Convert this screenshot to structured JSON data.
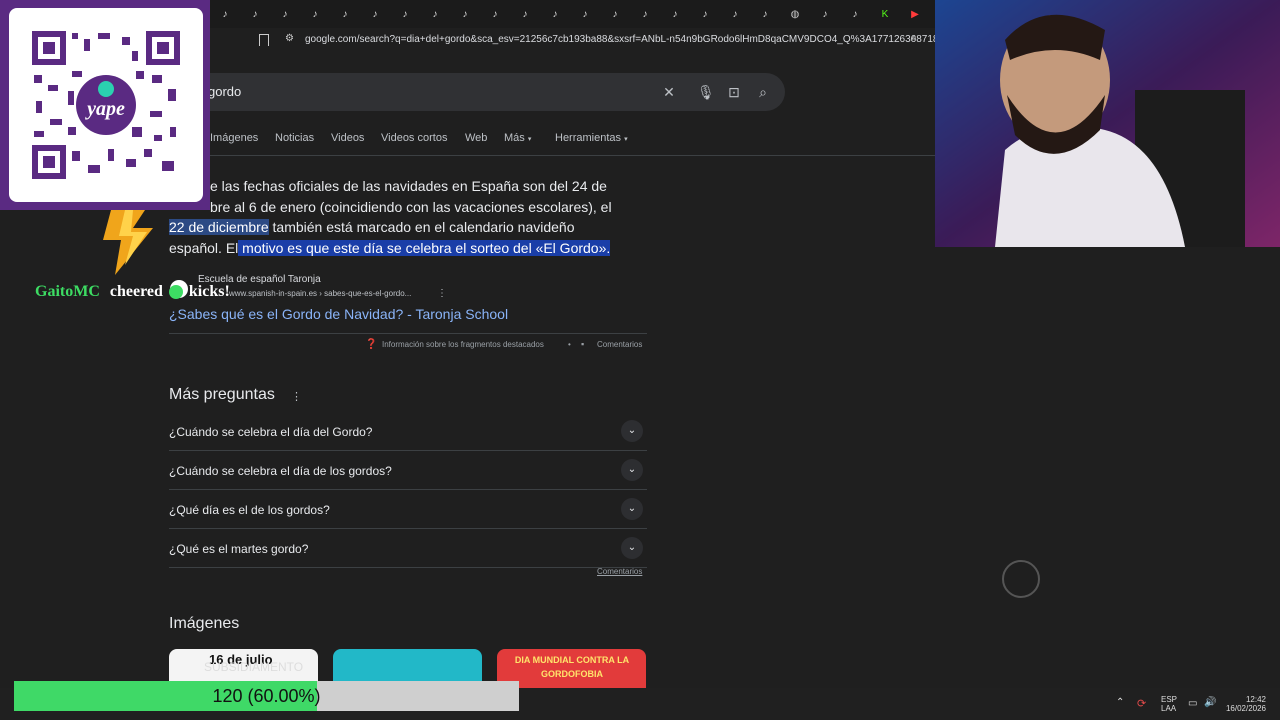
{
  "browser": {
    "url": "google.com/search?q=dia+del+gordo&sca_esv=21256c7cb193ba88&sxsrf=ANbL-n54n9bGRodo6lHmD8qaCMV9DCO4_Q%3A1771263687183...",
    "tab_icons": [
      "tiktok-icon",
      "tiktok-icon",
      "tiktok-icon",
      "tiktok-icon",
      "tiktok-icon",
      "tiktok-icon",
      "tiktok-icon",
      "tiktok-icon",
      "tiktok-icon",
      "tiktok-icon",
      "tiktok-icon",
      "tiktok-icon",
      "tiktok-icon",
      "tiktok-icon",
      "tiktok-icon",
      "tiktok-icon",
      "tiktok-icon",
      "tiktok-icon",
      "tiktok-icon",
      "globe-icon",
      "tiktok-icon",
      "tiktok-icon",
      "kick-icon",
      "youtube-icon",
      "tiktok-icon"
    ]
  },
  "search": {
    "query": "gordo"
  },
  "nav": {
    "images": "Imágenes",
    "news": "Noticias",
    "videos": "Videos",
    "short_videos": "Videos cortos",
    "web": "Web",
    "more": "Más",
    "tools": "Herramientas"
  },
  "snippet": {
    "part1": "e las fechas oficiales de las navidades en España son del 24 de",
    "part2": "bre al 6 de enero (coincidiendo con las vacaciones escolares), el",
    "highlight_date": "22 de diciembre",
    "part3": " también está marcado en el calendario navideño",
    "part4": "español. El",
    "highlight_reason": " motivo es que este día se celebra el sorteo del «El Gordo».",
    "source_name": "Escuela de español Taronja",
    "source_url": "www.spanish-in-spain.es › sabes-que-es-el-gordo...",
    "link": "¿Sabes qué es el Gordo de Navidad? - Taronja School",
    "info": "Información sobre los fragmentos destacados",
    "dot": "•",
    "comments": "Comentarios"
  },
  "paa": {
    "title": "Más preguntas",
    "questions": [
      "¿Cuándo se celebra el día del Gordo?",
      "¿Cuándo se celebra el día de los gordos?",
      "¿Qué día es el de los gordos?",
      "¿Qué es el martes gordo?"
    ],
    "comments": "Comentarios"
  },
  "images": {
    "title": "Imágenes",
    "thumb1": "16 de julio",
    "thumb3": "DIA MUNDIAL CONTRA LA GORDOFOBIA"
  },
  "overlay": {
    "cheer_user": "GaitoMC",
    "cheer_text": "cheered",
    "cheer_tail": "kicks!",
    "sub_text": "SUBSIDIAMENTO",
    "progress_label": "120 (60.00%)",
    "progress_fraction": 0.6,
    "qr_brand": "yape"
  },
  "tray": {
    "lang1": "ESP",
    "lang2": "LAA",
    "time": "12:42",
    "date": "16/02/2026"
  },
  "colors": {
    "page_bg": "#1f1f1f",
    "link": "#8ab4f8",
    "highlight": "#1a3ea8",
    "progress": "#3fd967",
    "yape_purple": "#5a2a82"
  }
}
